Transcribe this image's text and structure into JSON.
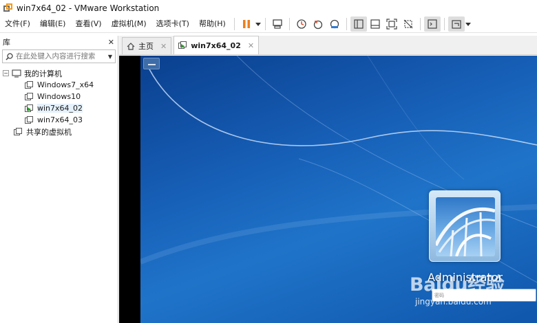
{
  "window": {
    "title": "win7x64_02 - VMware Workstation"
  },
  "menu": {
    "items": [
      "文件(F)",
      "编辑(E)",
      "查看(V)",
      "虚拟机(M)",
      "选项卡(T)",
      "帮助(H)"
    ]
  },
  "toolbar": {
    "icons": [
      "pause-icon",
      "send-keys-icon",
      "snapshot-icon",
      "revert-snapshot-icon",
      "snapshot-manager-icon",
      "library-view-icon",
      "thumbnail-view-icon",
      "fullscreen-icon",
      "unity-icon",
      "console-icon",
      "display-settings-icon"
    ]
  },
  "library": {
    "title": "库",
    "close": "✕",
    "search_placeholder": "在此处键入内容进行搜索",
    "tree": {
      "root_label": "我的计算机",
      "vms": [
        "Windows7_x64",
        "Windows10",
        "win7x64_02",
        "win7x64_03"
      ],
      "selected_vm": "win7x64_02",
      "shared_label": "共享的虚拟机"
    }
  },
  "tabs": [
    {
      "label": "主页",
      "close": "✕"
    },
    {
      "label": "win7x64_02",
      "close": "✕"
    }
  ],
  "guest": {
    "username": "Administrator",
    "password_placeholder": "密码",
    "go_arrow": "➜"
  },
  "watermark": {
    "logo": "Baidu经验",
    "url": "jingyan.baidu.com"
  },
  "colors": {
    "accent_orange": "#f29a1a",
    "desktop_blue": "#1760b8",
    "pause_orange": "#f07e1b"
  }
}
